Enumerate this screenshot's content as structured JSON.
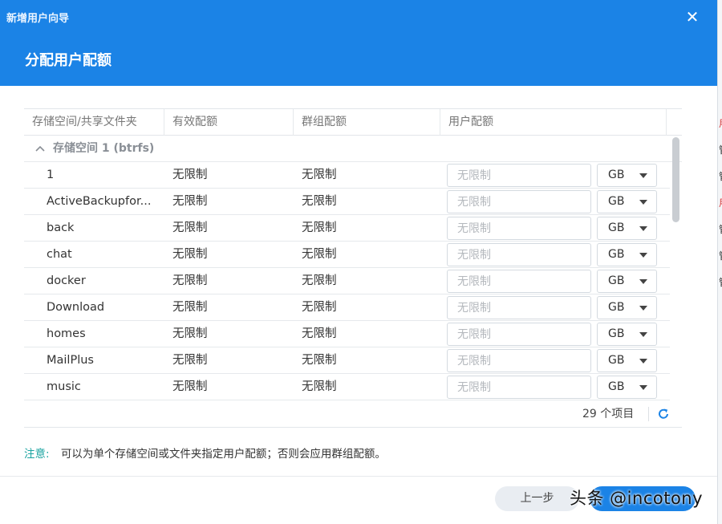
{
  "dialog": {
    "window_title": "新增用户向导",
    "page_title": "分配用户配额",
    "close_glyph": "✕"
  },
  "table": {
    "headers": [
      "存储空间/共享文件夹",
      "有效配额",
      "群组配额",
      "用户配额"
    ],
    "group_label": "存储空间 1 (btrfs)",
    "rows": [
      {
        "name": "1",
        "effective": "无限制",
        "group": "无限制",
        "placeholder": "无限制",
        "unit": "GB"
      },
      {
        "name": "ActiveBackupfor...",
        "effective": "无限制",
        "group": "无限制",
        "placeholder": "无限制",
        "unit": "GB"
      },
      {
        "name": "back",
        "effective": "无限制",
        "group": "无限制",
        "placeholder": "无限制",
        "unit": "GB"
      },
      {
        "name": "chat",
        "effective": "无限制",
        "group": "无限制",
        "placeholder": "无限制",
        "unit": "GB"
      },
      {
        "name": "docker",
        "effective": "无限制",
        "group": "无限制",
        "placeholder": "无限制",
        "unit": "GB"
      },
      {
        "name": "Download",
        "effective": "无限制",
        "group": "无限制",
        "placeholder": "无限制",
        "unit": "GB"
      },
      {
        "name": "homes",
        "effective": "无限制",
        "group": "无限制",
        "placeholder": "无限制",
        "unit": "GB"
      },
      {
        "name": "MailPlus",
        "effective": "无限制",
        "group": "无限制",
        "placeholder": "无限制",
        "unit": "GB"
      },
      {
        "name": "music",
        "effective": "无限制",
        "group": "无限制",
        "placeholder": "无限制",
        "unit": "GB"
      }
    ],
    "item_count": "29 个项目"
  },
  "note": {
    "label": "注意:",
    "text": "可以为单个存储空间或文件夹指定用户配额；否则会应用群组配额。"
  },
  "buttons": {
    "prev": "上一步",
    "next": ""
  },
  "watermark": "头条 @incotony",
  "background_strip": [
    "用",
    "管",
    "管",
    "用",
    "管",
    "管",
    "管"
  ],
  "colors": {
    "accent": "#1b83e6",
    "note_label": "#1aa3a0",
    "strip_red": "#d9383a"
  },
  "icons": {
    "close": "close-icon",
    "collapse": "chevron-up-icon",
    "dropdown": "caret-down-icon",
    "refresh": "refresh-icon"
  }
}
